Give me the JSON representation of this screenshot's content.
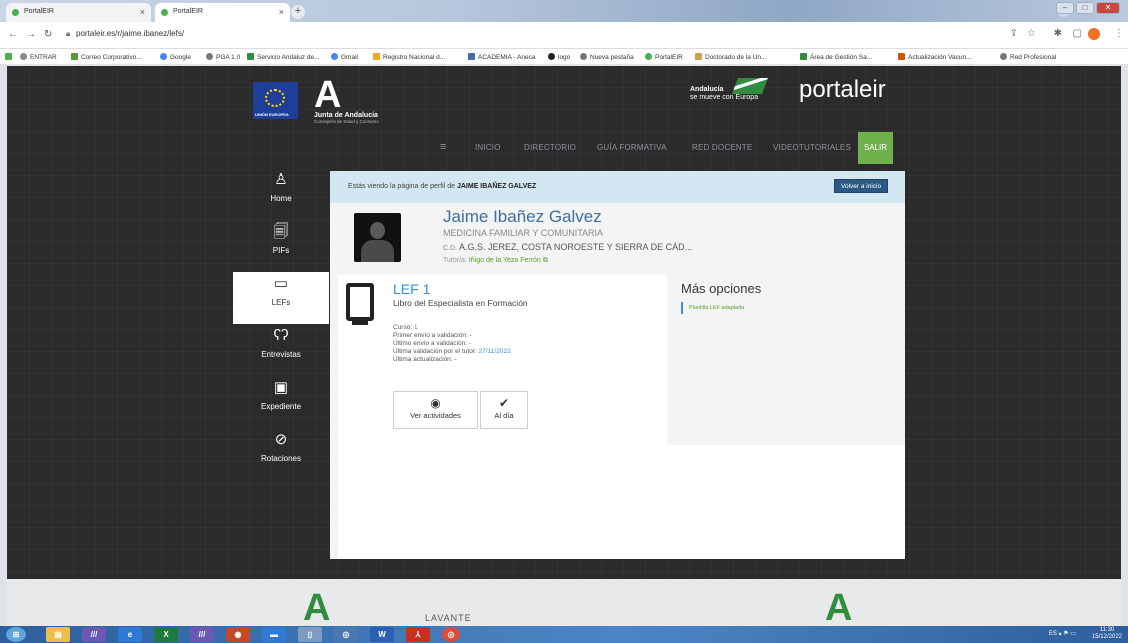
{
  "browser": {
    "tabs": [
      {
        "label": "PortalEIR",
        "active": false
      },
      {
        "label": "PortalEIR",
        "active": true
      }
    ],
    "url": "portaleir.es/r/jaime.ibanez/lefs/",
    "bookmarks": [
      "ENTRAR",
      "Correo Corporativo...",
      "Google",
      "PGA 1.0",
      "Servicio Andaluz de...",
      "Gmail",
      "Registro Nacional d...",
      "ACADEMIA - Aneca",
      "logo",
      "Nueva pestaña",
      "PortalEIR",
      "Doctorado de la Un...",
      "Área de Gestión Sa...",
      "Actualización Vacun...",
      "Red Profesional"
    ]
  },
  "header": {
    "eu_label": "UNIÓN EUROPEA",
    "junta_name": "Junta de Andalucía",
    "junta_sub": "Consejería de Salud y Consumo",
    "andalucia_line1": "Andalucía",
    "andalucia_line2": "se mueve con Europa",
    "brand": "portaleir"
  },
  "topnav": {
    "items": [
      "INICIO",
      "DIRECTORIO",
      "GUÍA FORMATIVA",
      "RED DOCENTE",
      "VIDEOTUTORIALES"
    ],
    "salir": "SALIR"
  },
  "sidebar": {
    "items": [
      {
        "label": "Home",
        "icon": "user-tie-icon"
      },
      {
        "label": "PIFs",
        "icon": "documents-icon"
      },
      {
        "label": "LEFs",
        "icon": "book-icon",
        "active": true
      },
      {
        "label": "Entrevistas",
        "icon": "footprints-icon"
      },
      {
        "label": "Expediente",
        "icon": "file-id-icon"
      },
      {
        "label": "Rotaciones",
        "icon": "check-circle-icon"
      }
    ]
  },
  "banner": {
    "prefix": "Estás viendo la página de perfil de ",
    "name": "JAIME IBAÑEZ GALVEZ",
    "volver": "Volver a inicio"
  },
  "profile": {
    "name": "Jaime Ibañez Galvez",
    "specialty": "MEDICINA FAMILIAR Y COMUNITARIA",
    "centro_prefix": "C.D.",
    "centro": "A.G.S. JEREZ, COSTA NOROESTE Y SIERRA DE CÁD...",
    "tutor_prefix": "Tutor/a:",
    "tutor": "Iñigo de la Yeza Ferrón"
  },
  "lef": {
    "title": "LEF 1",
    "subtitle": "Libro del Especialista en Formación",
    "curso_label": "Curso:",
    "curso_value": "1",
    "primer_label": "Primer envío a validación:",
    "primer_value": "-",
    "ultimo_label": "Último envío a validación:",
    "ultimo_value": "-",
    "validacion_label": "Última validación por el tutor:",
    "validacion_value": "27/11/2022",
    "actualizacion_label": "Última actualización:",
    "actualizacion_value": "-",
    "btn_ver": "Ver actividades",
    "btn_aldia": "Al día"
  },
  "mas_opciones": {
    "title": "Más opciones",
    "link": "Plantilla LEF adaptada"
  },
  "footer": {
    "text": "LAVANTE"
  },
  "taskbar": {
    "lang": "ES",
    "time": "11:30",
    "date": "15/12/2022"
  },
  "colors": {
    "accent_green": "#6fb04a",
    "link_blue": "#3b8fd4",
    "banner_bg": "#d3e7f2"
  }
}
